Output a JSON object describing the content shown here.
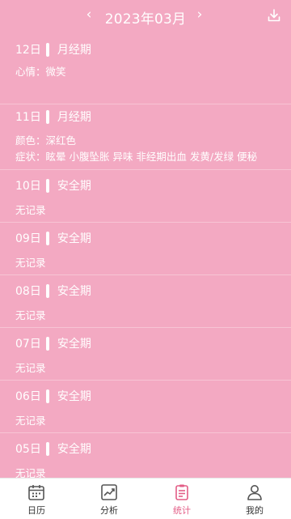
{
  "header": {
    "month": "2023年03月",
    "prev_icon": "chevron-left-icon",
    "next_icon": "chevron-right-icon",
    "download_icon": "download-icon"
  },
  "entries": [
    {
      "day": "12日",
      "type": "月经期",
      "lines": [
        "心情：微笑"
      ]
    },
    {
      "day": "11日",
      "type": "月经期",
      "lines": [
        "颜色：深红色",
        "症状：眩晕 小腹坠胀 异味 非经期出血 发黄/发绿 便秘"
      ]
    },
    {
      "day": "10日",
      "type": "安全期",
      "lines": [
        "无记录"
      ]
    },
    {
      "day": "09日",
      "type": "安全期",
      "lines": [
        "无记录"
      ]
    },
    {
      "day": "08日",
      "type": "安全期",
      "lines": [
        "无记录"
      ]
    },
    {
      "day": "07日",
      "type": "安全期",
      "lines": [
        "无记录"
      ]
    },
    {
      "day": "06日",
      "type": "安全期",
      "lines": [
        "无记录"
      ]
    },
    {
      "day": "05日",
      "type": "安全期",
      "lines": [
        "无记录"
      ]
    }
  ],
  "tabs": [
    {
      "label": "日历",
      "icon": "calendar-icon",
      "active": false
    },
    {
      "label": "分析",
      "icon": "chart-icon",
      "active": false
    },
    {
      "label": "统计",
      "icon": "clipboard-icon",
      "active": true
    },
    {
      "label": "我的",
      "icon": "user-icon",
      "active": false
    }
  ],
  "colors": {
    "background": "#f3a9c2",
    "accent": "#e35d86",
    "text": "#ffffff"
  }
}
